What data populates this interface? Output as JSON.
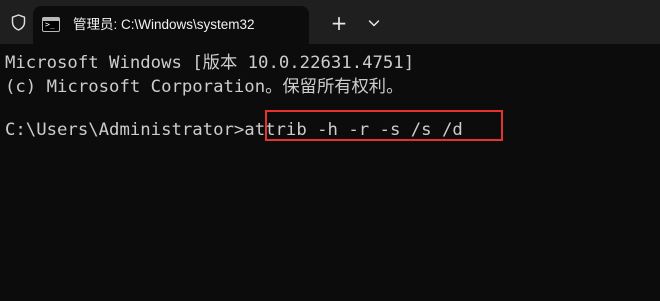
{
  "tab": {
    "title": "管理员: C:\\Windows\\system32",
    "icon_text": ">_"
  },
  "toolbar": {
    "close_glyph": "✕",
    "new_tab_glyph": "+"
  },
  "terminal": {
    "line1": "Microsoft Windows [版本 10.0.22631.4751]",
    "line2": "(c) Microsoft Corporation。保留所有权利。",
    "prompt": "C:\\Users\\Administrator>",
    "command": "attrib -h -r -s /s /d"
  },
  "colors": {
    "background": "#0c0c0c",
    "titlebar": "#1f1f1f",
    "text": "#cccccc",
    "highlight_box": "#e5322d"
  },
  "icons": [
    "shield-icon",
    "terminal-app-icon",
    "close-icon",
    "plus-icon",
    "chevron-down-icon"
  ]
}
